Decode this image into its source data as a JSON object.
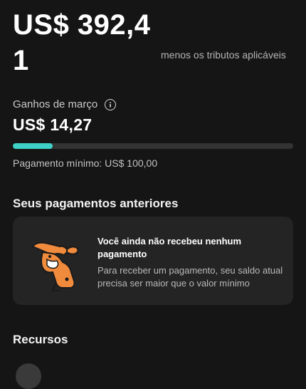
{
  "balance": {
    "amount": "US$ 392,41",
    "note": "menos os tributos aplicáveis"
  },
  "earnings": {
    "label": "Ganhos de março",
    "value": "US$ 14,27",
    "progress_fraction": 0.1427,
    "min_payment_text": "Pagamento mínimo: US$ 100,00"
  },
  "previous_payments": {
    "title": "Seus pagamentos anteriores",
    "empty_title": "Você ainda não recebeu nenhum pagamento",
    "empty_desc": "Para receber um pagamento, seu saldo atual precisa ser maior que o valor mínimo"
  },
  "resources": {
    "title": "Recursos"
  },
  "colors": {
    "accent": "#3fd1c8",
    "illustration": "#f08a3c"
  }
}
